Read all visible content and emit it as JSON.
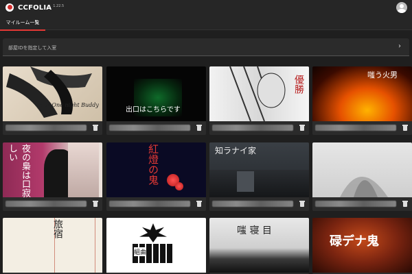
{
  "app": {
    "brand": "CCFOLIA",
    "version": "1.22.5"
  },
  "tabs": [
    {
      "label": "マイルーム一覧",
      "active": true
    }
  ],
  "room_search": {
    "placeholder": "部屋IDを指定して入室"
  },
  "colors": {
    "accent": "#e53935",
    "background": "#1f1f1f"
  },
  "rooms": [
    {
      "title_text": "Pour One night Buddy"
    },
    {
      "title_text": "出口はこちらです"
    },
    {
      "title_text": "優勝"
    },
    {
      "title_text": "嗤う火男"
    },
    {
      "title_text": "夜の梟は口寂しい"
    },
    {
      "title_text": "紅燈の鬼"
    },
    {
      "title_text": "知ラナイ家"
    },
    {
      "title_text": ""
    },
    {
      "title_text": "旅宿"
    },
    {
      "title_text": "組曲"
    },
    {
      "title_text": "嗤 寝 目"
    },
    {
      "title_text": "碌デナ鬼"
    }
  ]
}
